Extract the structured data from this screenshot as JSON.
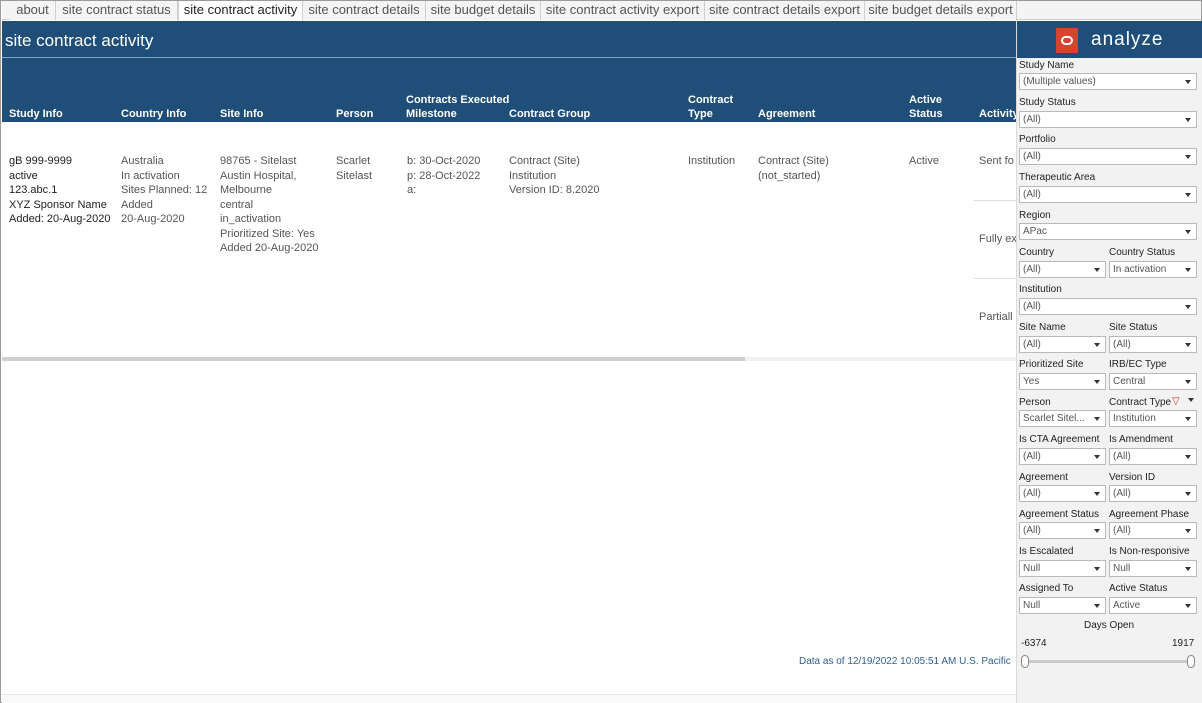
{
  "tabs": [
    {
      "label": "about",
      "active": false
    },
    {
      "label": "site contract status",
      "active": false
    },
    {
      "label": "site contract activity",
      "active": true
    },
    {
      "label": "site contract details",
      "active": false
    },
    {
      "label": "site budget details",
      "active": false
    },
    {
      "label": "site contract activity export",
      "active": false
    },
    {
      "label": "site contract details export",
      "active": false
    },
    {
      "label": "site budget details export",
      "active": false
    }
  ],
  "page_title": "site contract activity",
  "brand": {
    "name": "analyze",
    "accent": "#d6432f",
    "header_color": "#1f4e79"
  },
  "columns": {
    "study_info": "Study Info",
    "country_info": "Country Info",
    "site_info": "Site Info",
    "person": "Person",
    "contracts_executed_milestone": [
      "Contracts Executed",
      "Milestone"
    ],
    "contract_group": "Contract Group",
    "contract_type": [
      "Contract",
      "Type"
    ],
    "agreement": "Agreement",
    "active_status": [
      "Active",
      "Status"
    ],
    "activity": "Activity"
  },
  "row": {
    "study_info": [
      "gB 999-9999",
      "active",
      "123.abc.1",
      "XYZ Sponsor Name",
      "Added: 20-Aug-2020"
    ],
    "country_info": [
      "Australia",
      "In activation",
      "Sites Planned: 12",
      "Added",
      "20-Aug-2020"
    ],
    "site_info": [
      "98765 - Sitelast",
      "Austin Hospital,",
      "Melbourne",
      "central",
      "in_activation",
      "Prioritized Site: Yes",
      "Added 20-Aug-2020"
    ],
    "person": [
      "Scarlet",
      "Sitelast"
    ],
    "milestone": [
      "b: 30-Oct-2020",
      "p: 28-Oct-2022",
      "a:"
    ],
    "contract_group": [
      "Contract (Site)",
      "Institution",
      "Version ID: 8.2020"
    ],
    "contract_type": "Institution",
    "agreement": [
      "Contract (Site)",
      "(not_started)"
    ],
    "active_status": "Active",
    "activities": [
      "Sent fo",
      "Fully ex",
      "Partiall"
    ]
  },
  "data_as_of": "Data as of 12/19/2022 10:05:51 AM U.S. Pacific",
  "filters": {
    "study_name": {
      "label": "Study Name",
      "value": "(Multiple values)"
    },
    "study_status": {
      "label": "Study Status",
      "value": "(All)"
    },
    "portfolio": {
      "label": "Portfolio",
      "value": "(All)"
    },
    "therapeutic_area": {
      "label": "Therapeutic Area",
      "value": "(All)"
    },
    "region": {
      "label": "Region",
      "value": "APac"
    },
    "country": {
      "label": "Country",
      "value": "(All)"
    },
    "country_status": {
      "label": "Country Status",
      "value": "In activation"
    },
    "institution": {
      "label": "Institution",
      "value": "(All)"
    },
    "site_name": {
      "label": "Site Name",
      "value": "(All)"
    },
    "site_status": {
      "label": "Site Status",
      "value": "(All)"
    },
    "prioritized_site": {
      "label": "Prioritized Site",
      "value": "Yes"
    },
    "irb_ec_type": {
      "label": "IRB/EC Type",
      "value": "Central"
    },
    "person": {
      "label": "Person",
      "value": "Scarlet Sitel..."
    },
    "contract_type": {
      "label": "Contract Type",
      "value": "Institution"
    },
    "is_cta_agreement": {
      "label": "Is CTA Agreement",
      "value": "(All)"
    },
    "is_amendment": {
      "label": "Is Amendment",
      "value": "(All)"
    },
    "agreement": {
      "label": "Agreement",
      "value": "(All)"
    },
    "version_id": {
      "label": "Version ID",
      "value": "(All)"
    },
    "agreement_status": {
      "label": "Agreement Status",
      "value": "(All)"
    },
    "agreement_phase": {
      "label": "Agreement Phase",
      "value": "(All)"
    },
    "is_escalated": {
      "label": "Is Escalated",
      "value": "Null"
    },
    "is_non_responsive": {
      "label": "Is Non-responsive",
      "value": "Null"
    },
    "assigned_to": {
      "label": "Assigned To",
      "value": "Null"
    },
    "active_status": {
      "label": "Active Status",
      "value": "Active"
    }
  },
  "days_open": {
    "label": "Days Open",
    "min": "-6374",
    "max": "1917"
  }
}
